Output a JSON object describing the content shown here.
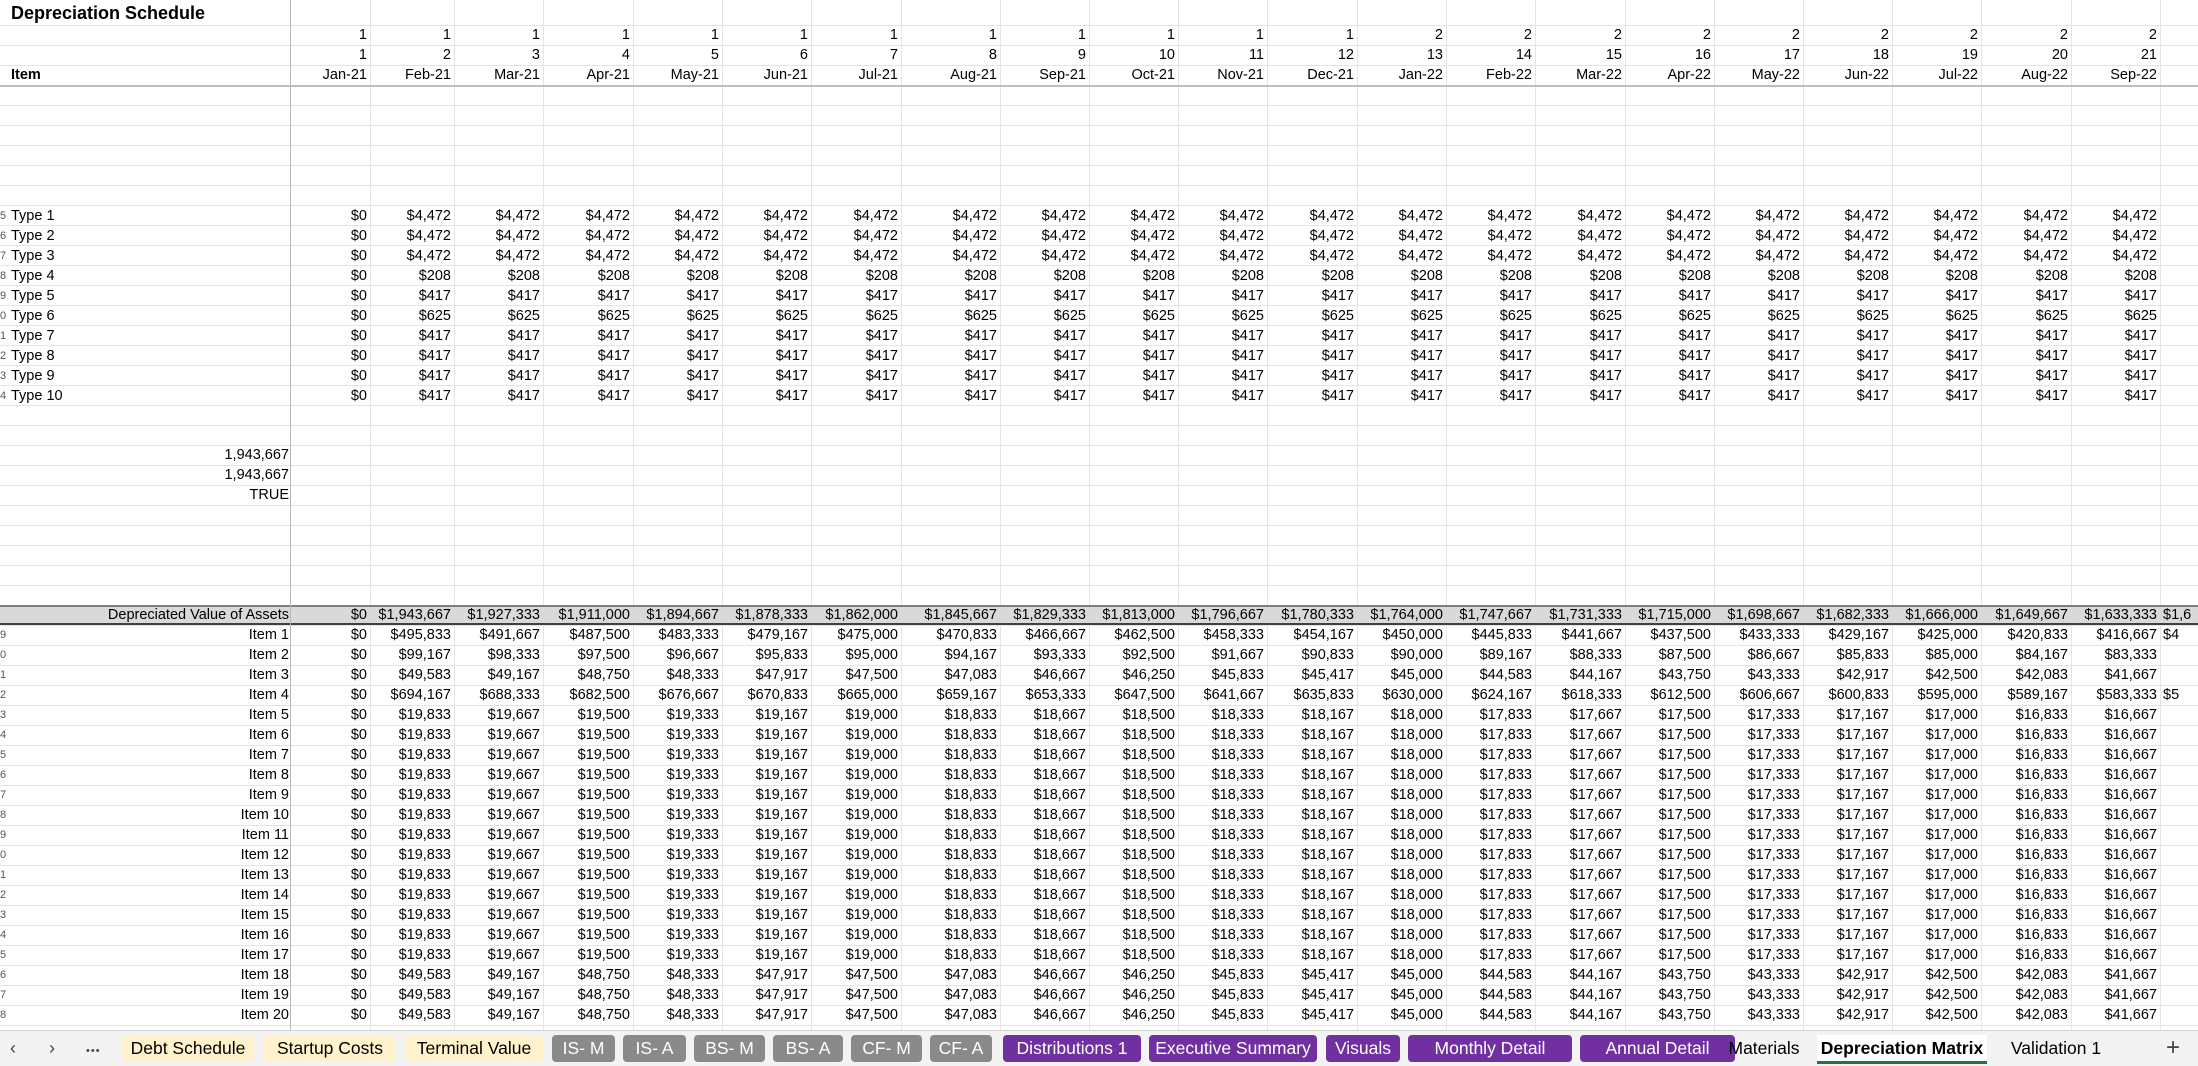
{
  "sheet": {
    "title": "Depreciation Schedule",
    "header": {
      "item_label": "Item",
      "year_row": [
        "1",
        "1",
        "1",
        "1",
        "1",
        "1",
        "1",
        "1",
        "1",
        "1",
        "1",
        "1",
        "2",
        "2",
        "2",
        "2",
        "2",
        "2",
        "2",
        "2",
        "2"
      ],
      "period_row": [
        "1",
        "2",
        "3",
        "4",
        "5",
        "6",
        "7",
        "8",
        "9",
        "10",
        "11",
        "12",
        "13",
        "14",
        "15",
        "16",
        "17",
        "18",
        "19",
        "20",
        "21"
      ],
      "months": [
        "Jan-21",
        "Feb-21",
        "Mar-21",
        "Apr-21",
        "May-21",
        "Jun-21",
        "Jul-21",
        "Aug-21",
        "Sep-21",
        "Oct-21",
        "Nov-21",
        "Dec-21",
        "Jan-22",
        "Feb-22",
        "Mar-22",
        "Apr-22",
        "May-22",
        "Jun-22",
        "Jul-22",
        "Aug-22",
        "Sep-22"
      ]
    },
    "type_rows": [
      {
        "label": "Type 1",
        "values": [
          "$0",
          "$4,472",
          "$4,472",
          "$4,472",
          "$4,472",
          "$4,472",
          "$4,472",
          "$4,472",
          "$4,472",
          "$4,472",
          "$4,472",
          "$4,472",
          "$4,472",
          "$4,472",
          "$4,472",
          "$4,472",
          "$4,472",
          "$4,472",
          "$4,472",
          "$4,472",
          "$4,472"
        ]
      },
      {
        "label": "Type 2",
        "values": [
          "$0",
          "$4,472",
          "$4,472",
          "$4,472",
          "$4,472",
          "$4,472",
          "$4,472",
          "$4,472",
          "$4,472",
          "$4,472",
          "$4,472",
          "$4,472",
          "$4,472",
          "$4,472",
          "$4,472",
          "$4,472",
          "$4,472",
          "$4,472",
          "$4,472",
          "$4,472",
          "$4,472"
        ]
      },
      {
        "label": "Type 3",
        "values": [
          "$0",
          "$4,472",
          "$4,472",
          "$4,472",
          "$4,472",
          "$4,472",
          "$4,472",
          "$4,472",
          "$4,472",
          "$4,472",
          "$4,472",
          "$4,472",
          "$4,472",
          "$4,472",
          "$4,472",
          "$4,472",
          "$4,472",
          "$4,472",
          "$4,472",
          "$4,472",
          "$4,472"
        ]
      },
      {
        "label": "Type 4",
        "values": [
          "$0",
          "$208",
          "$208",
          "$208",
          "$208",
          "$208",
          "$208",
          "$208",
          "$208",
          "$208",
          "$208",
          "$208",
          "$208",
          "$208",
          "$208",
          "$208",
          "$208",
          "$208",
          "$208",
          "$208",
          "$208"
        ]
      },
      {
        "label": "Type 5",
        "values": [
          "$0",
          "$417",
          "$417",
          "$417",
          "$417",
          "$417",
          "$417",
          "$417",
          "$417",
          "$417",
          "$417",
          "$417",
          "$417",
          "$417",
          "$417",
          "$417",
          "$417",
          "$417",
          "$417",
          "$417",
          "$417"
        ]
      },
      {
        "label": "Type 6",
        "values": [
          "$0",
          "$625",
          "$625",
          "$625",
          "$625",
          "$625",
          "$625",
          "$625",
          "$625",
          "$625",
          "$625",
          "$625",
          "$625",
          "$625",
          "$625",
          "$625",
          "$625",
          "$625",
          "$625",
          "$625",
          "$625"
        ]
      },
      {
        "label": "Type 7",
        "values": [
          "$0",
          "$417",
          "$417",
          "$417",
          "$417",
          "$417",
          "$417",
          "$417",
          "$417",
          "$417",
          "$417",
          "$417",
          "$417",
          "$417",
          "$417",
          "$417",
          "$417",
          "$417",
          "$417",
          "$417",
          "$417"
        ]
      },
      {
        "label": "Type 8",
        "values": [
          "$0",
          "$417",
          "$417",
          "$417",
          "$417",
          "$417",
          "$417",
          "$417",
          "$417",
          "$417",
          "$417",
          "$417",
          "$417",
          "$417",
          "$417",
          "$417",
          "$417",
          "$417",
          "$417",
          "$417",
          "$417"
        ]
      },
      {
        "label": "Type 9",
        "values": [
          "$0",
          "$417",
          "$417",
          "$417",
          "$417",
          "$417",
          "$417",
          "$417",
          "$417",
          "$417",
          "$417",
          "$417",
          "$417",
          "$417",
          "$417",
          "$417",
          "$417",
          "$417",
          "$417",
          "$417",
          "$417"
        ]
      },
      {
        "label": "Type 10",
        "values": [
          "$0",
          "$417",
          "$417",
          "$417",
          "$417",
          "$417",
          "$417",
          "$417",
          "$417",
          "$417",
          "$417",
          "$417",
          "$417",
          "$417",
          "$417",
          "$417",
          "$417",
          "$417",
          "$417",
          "$417",
          "$417"
        ]
      }
    ],
    "checks": [
      "1,943,667",
      "1,943,667",
      "TRUE"
    ],
    "depreciated": {
      "label": "Depreciated Value of Assets",
      "values": [
        "$0",
        "$1,943,667",
        "$1,927,333",
        "$1,911,000",
        "$1,894,667",
        "$1,878,333",
        "$1,862,000",
        "$1,845,667",
        "$1,829,333",
        "$1,813,000",
        "$1,796,667",
        "$1,780,333",
        "$1,764,000",
        "$1,747,667",
        "$1,731,333",
        "$1,715,000",
        "$1,698,667",
        "$1,682,333",
        "$1,666,000",
        "$1,649,667",
        "$1,633,333"
      ],
      "overflow": "$1,6"
    },
    "item_rows": [
      {
        "label": "Item 1",
        "values": [
          "$0",
          "$495,833",
          "$491,667",
          "$487,500",
          "$483,333",
          "$479,167",
          "$475,000",
          "$470,833",
          "$466,667",
          "$462,500",
          "$458,333",
          "$454,167",
          "$450,000",
          "$445,833",
          "$441,667",
          "$437,500",
          "$433,333",
          "$429,167",
          "$425,000",
          "$420,833",
          "$416,667"
        ],
        "overflow": "$4"
      },
      {
        "label": "Item 2",
        "values": [
          "$0",
          "$99,167",
          "$98,333",
          "$97,500",
          "$96,667",
          "$95,833",
          "$95,000",
          "$94,167",
          "$93,333",
          "$92,500",
          "$91,667",
          "$90,833",
          "$90,000",
          "$89,167",
          "$88,333",
          "$87,500",
          "$86,667",
          "$85,833",
          "$85,000",
          "$84,167",
          "$83,333"
        ]
      },
      {
        "label": "Item 3",
        "values": [
          "$0",
          "$49,583",
          "$49,167",
          "$48,750",
          "$48,333",
          "$47,917",
          "$47,500",
          "$47,083",
          "$46,667",
          "$46,250",
          "$45,833",
          "$45,417",
          "$45,000",
          "$44,583",
          "$44,167",
          "$43,750",
          "$43,333",
          "$42,917",
          "$42,500",
          "$42,083",
          "$41,667"
        ]
      },
      {
        "label": "Item 4",
        "values": [
          "$0",
          "$694,167",
          "$688,333",
          "$682,500",
          "$676,667",
          "$670,833",
          "$665,000",
          "$659,167",
          "$653,333",
          "$647,500",
          "$641,667",
          "$635,833",
          "$630,000",
          "$624,167",
          "$618,333",
          "$612,500",
          "$606,667",
          "$600,833",
          "$595,000",
          "$589,167",
          "$583,333"
        ],
        "overflow": "$5"
      },
      {
        "label": "Item 5",
        "values": [
          "$0",
          "$19,833",
          "$19,667",
          "$19,500",
          "$19,333",
          "$19,167",
          "$19,000",
          "$18,833",
          "$18,667",
          "$18,500",
          "$18,333",
          "$18,167",
          "$18,000",
          "$17,833",
          "$17,667",
          "$17,500",
          "$17,333",
          "$17,167",
          "$17,000",
          "$16,833",
          "$16,667"
        ]
      },
      {
        "label": "Item 6",
        "values": [
          "$0",
          "$19,833",
          "$19,667",
          "$19,500",
          "$19,333",
          "$19,167",
          "$19,000",
          "$18,833",
          "$18,667",
          "$18,500",
          "$18,333",
          "$18,167",
          "$18,000",
          "$17,833",
          "$17,667",
          "$17,500",
          "$17,333",
          "$17,167",
          "$17,000",
          "$16,833",
          "$16,667"
        ]
      },
      {
        "label": "Item 7",
        "values": [
          "$0",
          "$19,833",
          "$19,667",
          "$19,500",
          "$19,333",
          "$19,167",
          "$19,000",
          "$18,833",
          "$18,667",
          "$18,500",
          "$18,333",
          "$18,167",
          "$18,000",
          "$17,833",
          "$17,667",
          "$17,500",
          "$17,333",
          "$17,167",
          "$17,000",
          "$16,833",
          "$16,667"
        ]
      },
      {
        "label": "Item 8",
        "values": [
          "$0",
          "$19,833",
          "$19,667",
          "$19,500",
          "$19,333",
          "$19,167",
          "$19,000",
          "$18,833",
          "$18,667",
          "$18,500",
          "$18,333",
          "$18,167",
          "$18,000",
          "$17,833",
          "$17,667",
          "$17,500",
          "$17,333",
          "$17,167",
          "$17,000",
          "$16,833",
          "$16,667"
        ]
      },
      {
        "label": "Item 9",
        "values": [
          "$0",
          "$19,833",
          "$19,667",
          "$19,500",
          "$19,333",
          "$19,167",
          "$19,000",
          "$18,833",
          "$18,667",
          "$18,500",
          "$18,333",
          "$18,167",
          "$18,000",
          "$17,833",
          "$17,667",
          "$17,500",
          "$17,333",
          "$17,167",
          "$17,000",
          "$16,833",
          "$16,667"
        ]
      },
      {
        "label": "Item 10",
        "values": [
          "$0",
          "$19,833",
          "$19,667",
          "$19,500",
          "$19,333",
          "$19,167",
          "$19,000",
          "$18,833",
          "$18,667",
          "$18,500",
          "$18,333",
          "$18,167",
          "$18,000",
          "$17,833",
          "$17,667",
          "$17,500",
          "$17,333",
          "$17,167",
          "$17,000",
          "$16,833",
          "$16,667"
        ]
      },
      {
        "label": "Item 11",
        "values": [
          "$0",
          "$19,833",
          "$19,667",
          "$19,500",
          "$19,333",
          "$19,167",
          "$19,000",
          "$18,833",
          "$18,667",
          "$18,500",
          "$18,333",
          "$18,167",
          "$18,000",
          "$17,833",
          "$17,667",
          "$17,500",
          "$17,333",
          "$17,167",
          "$17,000",
          "$16,833",
          "$16,667"
        ]
      },
      {
        "label": "Item 12",
        "values": [
          "$0",
          "$19,833",
          "$19,667",
          "$19,500",
          "$19,333",
          "$19,167",
          "$19,000",
          "$18,833",
          "$18,667",
          "$18,500",
          "$18,333",
          "$18,167",
          "$18,000",
          "$17,833",
          "$17,667",
          "$17,500",
          "$17,333",
          "$17,167",
          "$17,000",
          "$16,833",
          "$16,667"
        ]
      },
      {
        "label": "Item 13",
        "values": [
          "$0",
          "$19,833",
          "$19,667",
          "$19,500",
          "$19,333",
          "$19,167",
          "$19,000",
          "$18,833",
          "$18,667",
          "$18,500",
          "$18,333",
          "$18,167",
          "$18,000",
          "$17,833",
          "$17,667",
          "$17,500",
          "$17,333",
          "$17,167",
          "$17,000",
          "$16,833",
          "$16,667"
        ]
      },
      {
        "label": "Item 14",
        "values": [
          "$0",
          "$19,833",
          "$19,667",
          "$19,500",
          "$19,333",
          "$19,167",
          "$19,000",
          "$18,833",
          "$18,667",
          "$18,500",
          "$18,333",
          "$18,167",
          "$18,000",
          "$17,833",
          "$17,667",
          "$17,500",
          "$17,333",
          "$17,167",
          "$17,000",
          "$16,833",
          "$16,667"
        ]
      },
      {
        "label": "Item 15",
        "values": [
          "$0",
          "$19,833",
          "$19,667",
          "$19,500",
          "$19,333",
          "$19,167",
          "$19,000",
          "$18,833",
          "$18,667",
          "$18,500",
          "$18,333",
          "$18,167",
          "$18,000",
          "$17,833",
          "$17,667",
          "$17,500",
          "$17,333",
          "$17,167",
          "$17,000",
          "$16,833",
          "$16,667"
        ]
      },
      {
        "label": "Item 16",
        "values": [
          "$0",
          "$19,833",
          "$19,667",
          "$19,500",
          "$19,333",
          "$19,167",
          "$19,000",
          "$18,833",
          "$18,667",
          "$18,500",
          "$18,333",
          "$18,167",
          "$18,000",
          "$17,833",
          "$17,667",
          "$17,500",
          "$17,333",
          "$17,167",
          "$17,000",
          "$16,833",
          "$16,667"
        ]
      },
      {
        "label": "Item 17",
        "values": [
          "$0",
          "$19,833",
          "$19,667",
          "$19,500",
          "$19,333",
          "$19,167",
          "$19,000",
          "$18,833",
          "$18,667",
          "$18,500",
          "$18,333",
          "$18,167",
          "$18,000",
          "$17,833",
          "$17,667",
          "$17,500",
          "$17,333",
          "$17,167",
          "$17,000",
          "$16,833",
          "$16,667"
        ]
      },
      {
        "label": "Item 18",
        "values": [
          "$0",
          "$49,583",
          "$49,167",
          "$48,750",
          "$48,333",
          "$47,917",
          "$47,500",
          "$47,083",
          "$46,667",
          "$46,250",
          "$45,833",
          "$45,417",
          "$45,000",
          "$44,583",
          "$44,167",
          "$43,750",
          "$43,333",
          "$42,917",
          "$42,500",
          "$42,083",
          "$41,667"
        ]
      },
      {
        "label": "Item 19",
        "values": [
          "$0",
          "$49,583",
          "$49,167",
          "$48,750",
          "$48,333",
          "$47,917",
          "$47,500",
          "$47,083",
          "$46,667",
          "$46,250",
          "$45,833",
          "$45,417",
          "$45,000",
          "$44,583",
          "$44,167",
          "$43,750",
          "$43,333",
          "$42,917",
          "$42,500",
          "$42,083",
          "$41,667"
        ]
      },
      {
        "label": "Item 20",
        "values": [
          "$0",
          "$49,583",
          "$49,167",
          "$48,750",
          "$48,333",
          "$47,917",
          "$47,500",
          "$47,083",
          "$46,667",
          "$46,250",
          "$45,833",
          "$45,417",
          "$45,000",
          "$44,583",
          "$44,167",
          "$43,750",
          "$43,333",
          "$42,917",
          "$42,500",
          "$42,083",
          "$41,667"
        ]
      }
    ]
  },
  "tabs": {
    "prev_icon": "chevron-left-icon",
    "next_icon": "chevron-right-icon",
    "more_icon": "ellipsis-icon",
    "add_icon": "plus-icon",
    "prev_glyph": "‹",
    "next_glyph": "›",
    "more_glyph": "•••",
    "add_glyph": "+",
    "colors": {
      "yellow": "#fff2cc",
      "gray": "#8a8a8a",
      "purple": "#7030a0",
      "active_underline": "#217346"
    },
    "items": [
      {
        "label": "Debt Schedule",
        "style": "yellow"
      },
      {
        "label": "Startup Costs",
        "style": "yellow"
      },
      {
        "label": "Terminal Value",
        "style": "yellow"
      },
      {
        "label": "IS- M",
        "style": "gray"
      },
      {
        "label": "IS- A",
        "style": "gray"
      },
      {
        "label": "BS- M",
        "style": "gray"
      },
      {
        "label": "BS- A",
        "style": "gray"
      },
      {
        "label": "CF- M",
        "style": "gray"
      },
      {
        "label": "CF- A",
        "style": "gray"
      },
      {
        "label": "Distributions 1",
        "style": "purple"
      },
      {
        "label": "Executive Summary",
        "style": "purple"
      },
      {
        "label": "Visuals",
        "style": "purple"
      },
      {
        "label": "Monthly Detail",
        "style": "purple"
      },
      {
        "label": "Annual Detail",
        "style": "purple"
      },
      {
        "label": "Materials",
        "style": "plain"
      },
      {
        "label": "Depreciation Matrix",
        "style": "active"
      },
      {
        "label": "Validation 1",
        "style": "plain"
      }
    ]
  }
}
